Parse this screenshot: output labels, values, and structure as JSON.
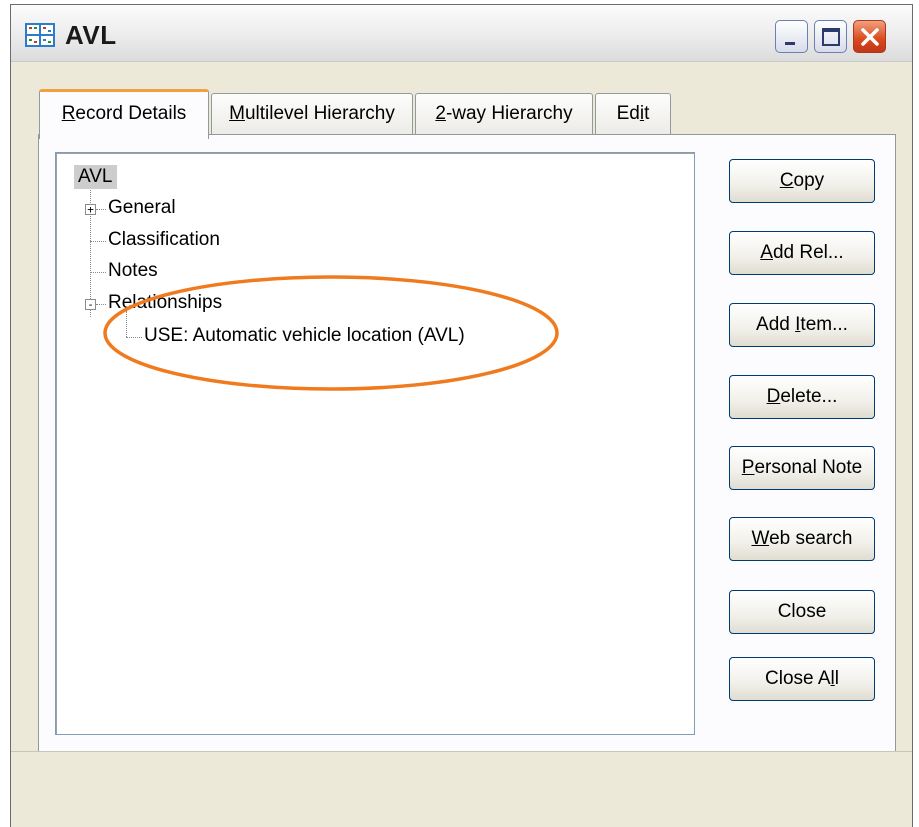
{
  "window": {
    "title": "AVL",
    "icon": "app-grid-icon"
  },
  "title_buttons": {
    "minimize_icon": "minimize-icon",
    "maximize_icon": "maximize-icon",
    "close_icon": "close-icon"
  },
  "tabs": [
    {
      "pre": "",
      "accel": "R",
      "post": "ecord Details",
      "active": true
    },
    {
      "pre": "",
      "accel": "M",
      "post": "ultilevel Hierarchy",
      "active": false
    },
    {
      "pre": "",
      "accel": "2",
      "post": "-way Hierarchy",
      "active": false
    },
    {
      "pre": "Ed",
      "accel": "i",
      "post": "t",
      "active": false
    }
  ],
  "tree": {
    "root": "AVL",
    "items": [
      {
        "label": "General",
        "expander": "+"
      },
      {
        "label": "Classification"
      },
      {
        "label": "Notes"
      },
      {
        "label": "Relationships",
        "expander": "-"
      }
    ],
    "child": "USE: Automatic vehicle location (AVL)"
  },
  "buttons": [
    {
      "pre": "",
      "accel": "C",
      "post": "opy"
    },
    {
      "pre": "",
      "accel": "A",
      "post": "dd Rel..."
    },
    {
      "pre": "Add ",
      "accel": "I",
      "post": "tem..."
    },
    {
      "pre": "",
      "accel": "D",
      "post": "elete..."
    },
    {
      "pre": "",
      "accel": "P",
      "post": "ersonal Note"
    },
    {
      "pre": "",
      "accel": "W",
      "post": "eb search"
    },
    {
      "pre": "Close",
      "accel": "",
      "post": ""
    },
    {
      "pre": "Close A",
      "accel": "l",
      "post": "l"
    }
  ],
  "colors": {
    "annotation": "#f07a1e",
    "tab_active_accent": "#f2a03c",
    "close_button": "#d9491d"
  }
}
